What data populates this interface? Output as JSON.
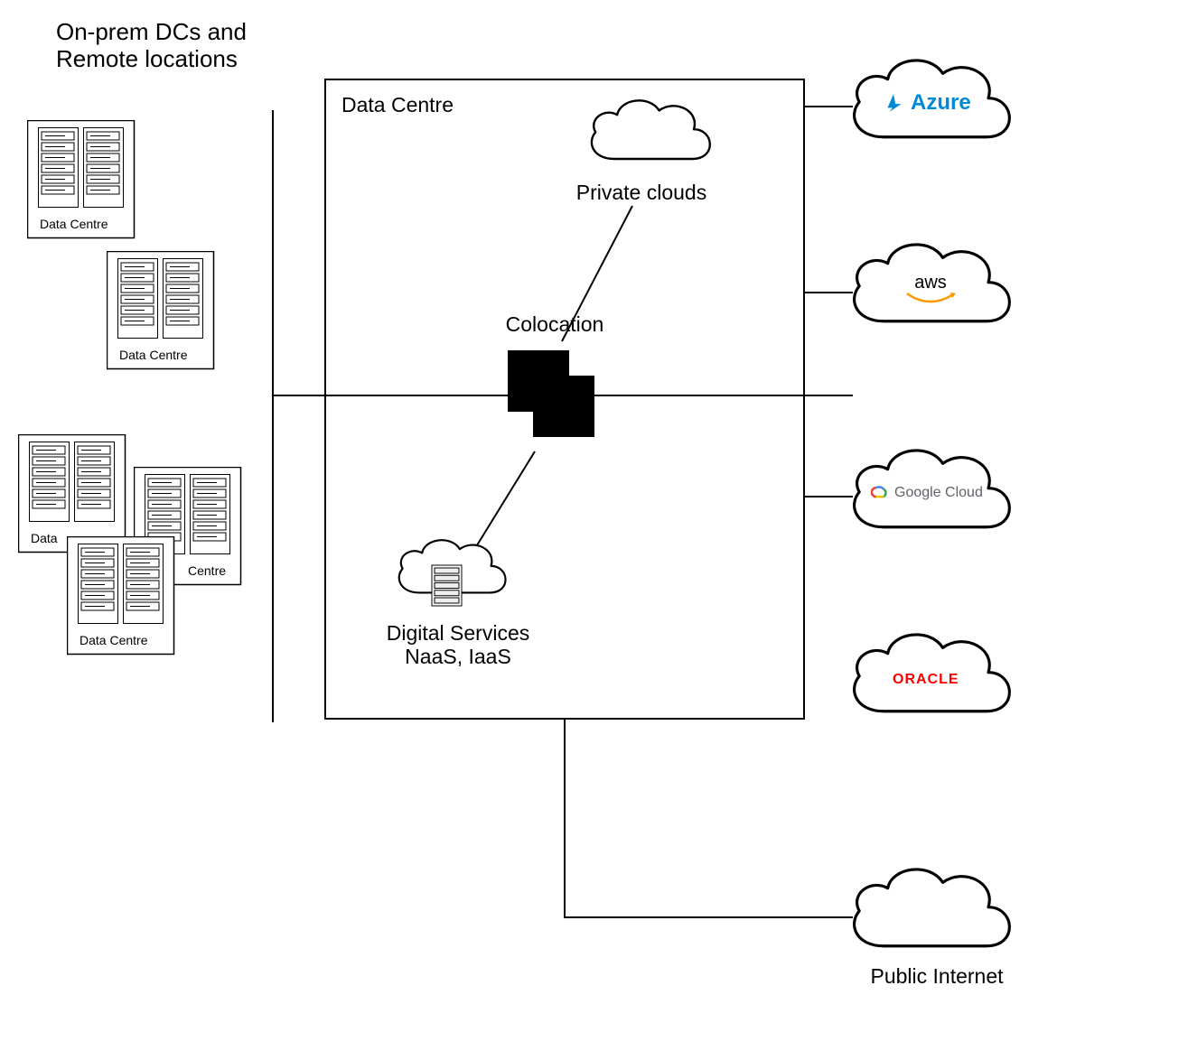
{
  "left": {
    "title_l1": "On-prem DCs and",
    "title_l2": "Remote locations",
    "rack1_caption": "Data Centre",
    "rack2_caption": "Data Centre",
    "rack3_caption": "Data",
    "rack4_caption": "Centre",
    "rack5_caption": "Data Centre"
  },
  "main": {
    "box_title": "Data Centre",
    "private_clouds": "Private clouds",
    "colocation": "Colocation",
    "digital_l1": "Digital Services",
    "digital_l2": "NaaS, IaaS"
  },
  "right": {
    "azure": "Azure",
    "aws": "aws",
    "gcloud": "Google Cloud",
    "oracle": "ORACLE",
    "internet": "Public Internet"
  }
}
